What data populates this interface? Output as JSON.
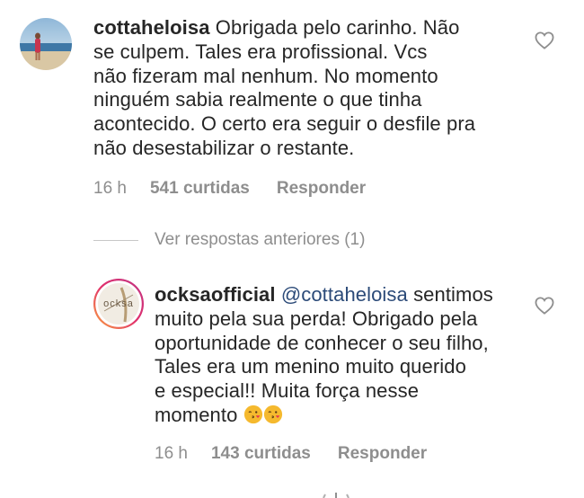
{
  "comments": [
    {
      "username": "cottaheloisa",
      "text": "Obrigada pelo carinho. Não se culpem. Tales era profissional.  Vcs não fizeram mal nenhum. No momento ninguém sabia realmente o que tinha acontecido. O certo era seguir o desfile pra não desestabilizar o restante.",
      "time": "16 h",
      "likes": "541 curtidas",
      "reply_label": "Responder",
      "lines": [
        "Obrigada pelo carinho. Não",
        "se culpem. Tales era profissional.  Vcs",
        "não fizeram mal nenhum. No momento",
        "ninguém sabia realmente o que tinha",
        "acontecido. O certo era seguir o desfile pra",
        "não desestabilizar o restante."
      ]
    },
    {
      "username": "ocksaofficial",
      "mention": "@cottaheloisa",
      "text": "sentimos muito pela sua perda! Obrigado pela oportunidade de conhecer o seu filho, Tales era um menino muito querido e especial!! Muita força nesse momento",
      "lines": [
        "sentimos",
        "muito pela sua perda! Obrigado pela",
        "oportunidade de conhecer o seu filho,",
        "Tales era um menino muito querido",
        "e especial!! Muita força nesse",
        "momento"
      ],
      "emoji": "kissing-face-emoji",
      "time": "16 h",
      "likes": "143 curtidas",
      "reply_label": "Responder",
      "avatar_text": "ocksa"
    }
  ],
  "view_previous_replies": "Ver respostas anteriores (1)",
  "colors": {
    "text": "#262626",
    "muted": "#8e8e8e",
    "mention": "#2b4a78"
  }
}
